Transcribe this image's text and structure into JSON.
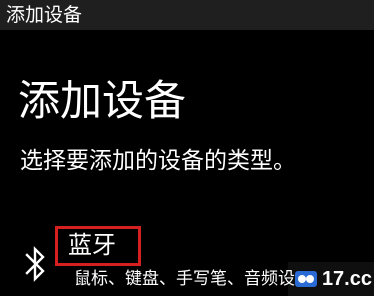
{
  "window": {
    "title": "添加设备"
  },
  "page": {
    "heading": "添加设备",
    "subtitle": "选择要添加的设备的类型。"
  },
  "options": [
    {
      "icon": "bluetooth-icon",
      "title": "蓝牙",
      "description": "鼠标、键盘、手写笔、音频设"
    }
  ],
  "watermark": {
    "text": "17.cc"
  },
  "colors": {
    "background": "#000000",
    "titlebar": "#1f1f1f",
    "text": "#ffffff",
    "highlight": "#d42020"
  }
}
